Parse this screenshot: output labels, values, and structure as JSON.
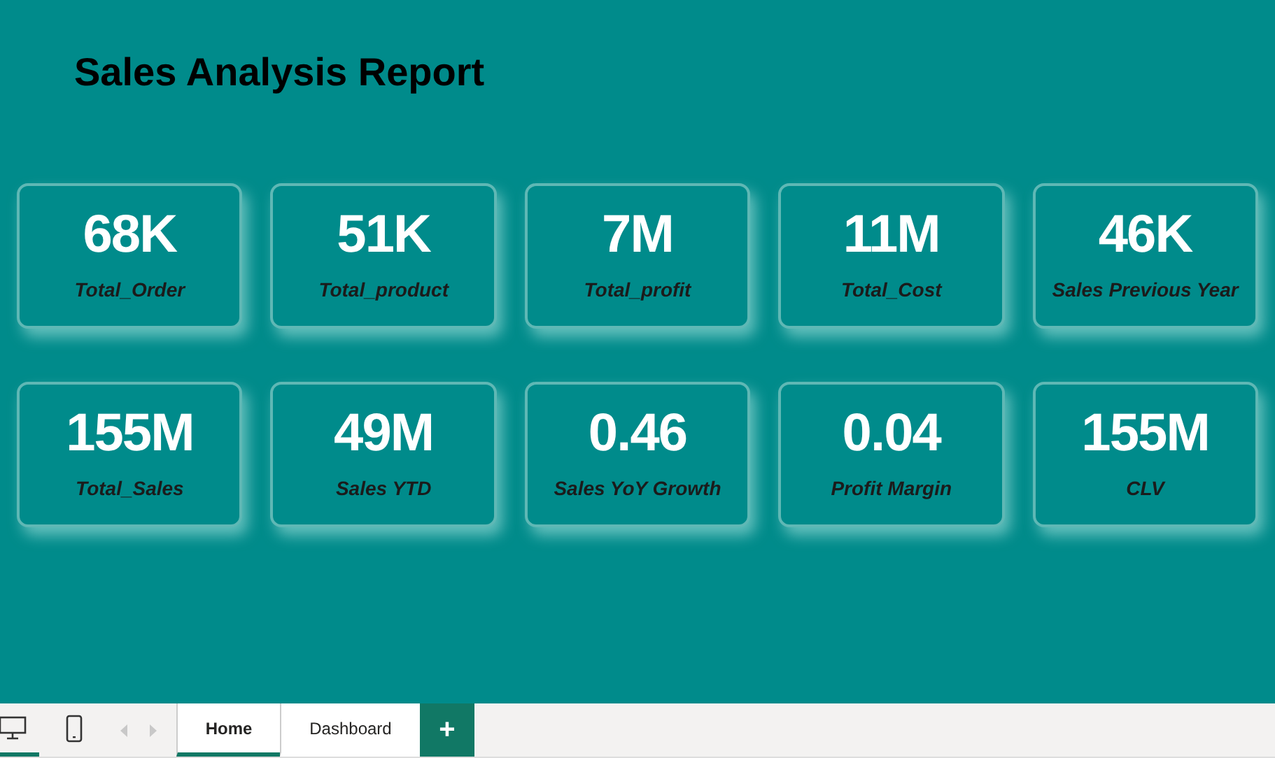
{
  "report": {
    "title": "Sales Analysis Report"
  },
  "kpi_rows": [
    [
      {
        "value": "68K",
        "label": "Total_Order"
      },
      {
        "value": "51K",
        "label": "Total_product"
      },
      {
        "value": "7M",
        "label": "Total_profit"
      },
      {
        "value": "11M",
        "label": "Total_Cost"
      },
      {
        "value": "46K",
        "label": "Sales Previous Year"
      }
    ],
    [
      {
        "value": "155M",
        "label": "Total_Sales"
      },
      {
        "value": "49M",
        "label": "Sales YTD"
      },
      {
        "value": "0.46",
        "label": "Sales YoY Growth"
      },
      {
        "value": "0.04",
        "label": "Profit Margin"
      },
      {
        "value": "155M",
        "label": "CLV"
      }
    ]
  ],
  "views": [
    {
      "kind": "desktop",
      "selected": true
    },
    {
      "kind": "phone",
      "selected": false
    }
  ],
  "page_tabs": [
    {
      "label": "Home",
      "selected": true
    },
    {
      "label": "Dashboard",
      "selected": false
    }
  ],
  "add_tab": {
    "label": "+"
  }
}
